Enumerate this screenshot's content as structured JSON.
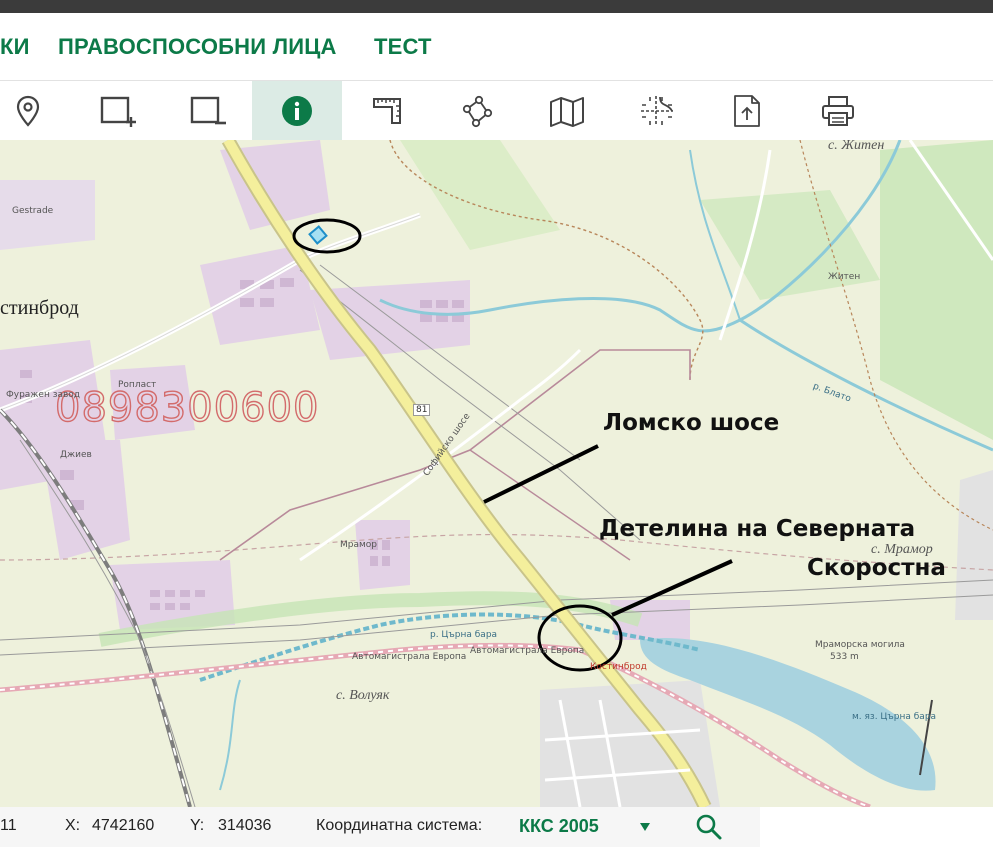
{
  "nav": {
    "items": [
      {
        "label": "КИ"
      },
      {
        "label": "ПРАВОСПОСОБНИ ЛИЦА"
      },
      {
        "label": "ТЕСТ"
      }
    ]
  },
  "toolbar": {
    "tools": [
      {
        "icon": "location-pin-icon"
      },
      {
        "icon": "select-add-icon"
      },
      {
        "icon": "select-remove-icon"
      },
      {
        "icon": "info-icon",
        "active": true
      },
      {
        "icon": "measure-area-icon"
      },
      {
        "icon": "polygon-draw-icon"
      },
      {
        "icon": "map-layers-icon"
      },
      {
        "icon": "cross-section-icon"
      },
      {
        "icon": "export-icon"
      },
      {
        "icon": "print-icon"
      }
    ],
    "accent_color": "#0c7a48"
  },
  "map": {
    "watermark_phone": "0898300600",
    "town_label": "стинброд",
    "place_labels": {
      "zhiten": "с. Житен",
      "mramor": "с. Мрамор",
      "volyak": "с. Волуяк"
    },
    "road_number": "81",
    "small_labels": {
      "gestrade": "Gestrade",
      "lom_road": "Софийско шосе",
      "zhiten_road": "Житен",
      "mramor_road": "Мрамор",
      "dzhiev": "Джиев",
      "motorway1": "Автомагистрала Европа",
      "motorway2": "Автомагистрала Европа",
      "kostinbrod": "Костинброд",
      "mogila": "Мраморска могила",
      "mogila_height": "533 m",
      "lake": "м. яз. Църна бара",
      "river": "р. Църна бара",
      "blato": "р. Блато",
      "furzhe": "Фуражен завод",
      "roplast": "Ропласт"
    },
    "annotations": {
      "lomsko": "Ломско шосе",
      "detelina_line1": "Детелина на Северната",
      "detelina_line2": "Скоростна"
    }
  },
  "status": {
    "scale_partial": "11",
    "x_label": "X:",
    "x_value": "4742160",
    "y_label": "Y:",
    "y_value": "314036",
    "crs_label": "Координатна система:",
    "crs_value": "ККС 2005",
    "dropdown_icon": "triangle-down-icon",
    "search_icon": "search-icon"
  }
}
